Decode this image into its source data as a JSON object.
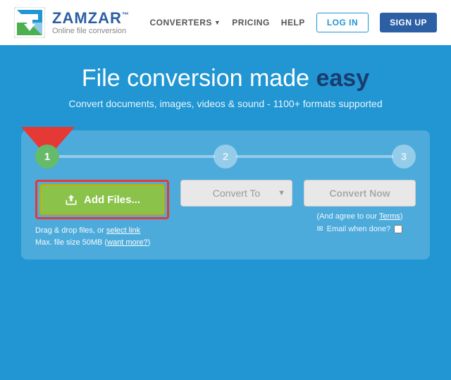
{
  "navbar": {
    "logo_title": "ZAMZAR",
    "logo_tm": "™",
    "logo_subtitle": "Online file conversion",
    "nav_converters": "CONVERTERS",
    "nav_pricing": "PRICING",
    "nav_help": "HELP",
    "btn_login": "LOG IN",
    "btn_signup": "SIGN UP"
  },
  "hero": {
    "title_part1": "File ",
    "title_part2": "conversion made ",
    "title_easy": "easy",
    "subtitle": "Convert documents, images, videos & sound - 1100+ formats supported"
  },
  "conversion": {
    "step1_label": "1",
    "step2_label": "2",
    "step3_label": "3",
    "add_files_btn": "Add Files...",
    "hint_line1": "Drag & drop files, or ",
    "hint_link": "select link",
    "hint_line2": "Max. file size 50MB (",
    "hint_link2": "want more?",
    "hint_line2_end": ")",
    "convert_to_placeholder": "Convert To",
    "convert_now_label": "Convert Now",
    "agree_text": "(And agree to our ",
    "agree_link": "Terms",
    "agree_end": ")",
    "email_label": "Email when done?",
    "steps": [
      {
        "number": "1",
        "active": true
      },
      {
        "number": "2",
        "active": false
      },
      {
        "number": "3",
        "active": false
      }
    ]
  }
}
